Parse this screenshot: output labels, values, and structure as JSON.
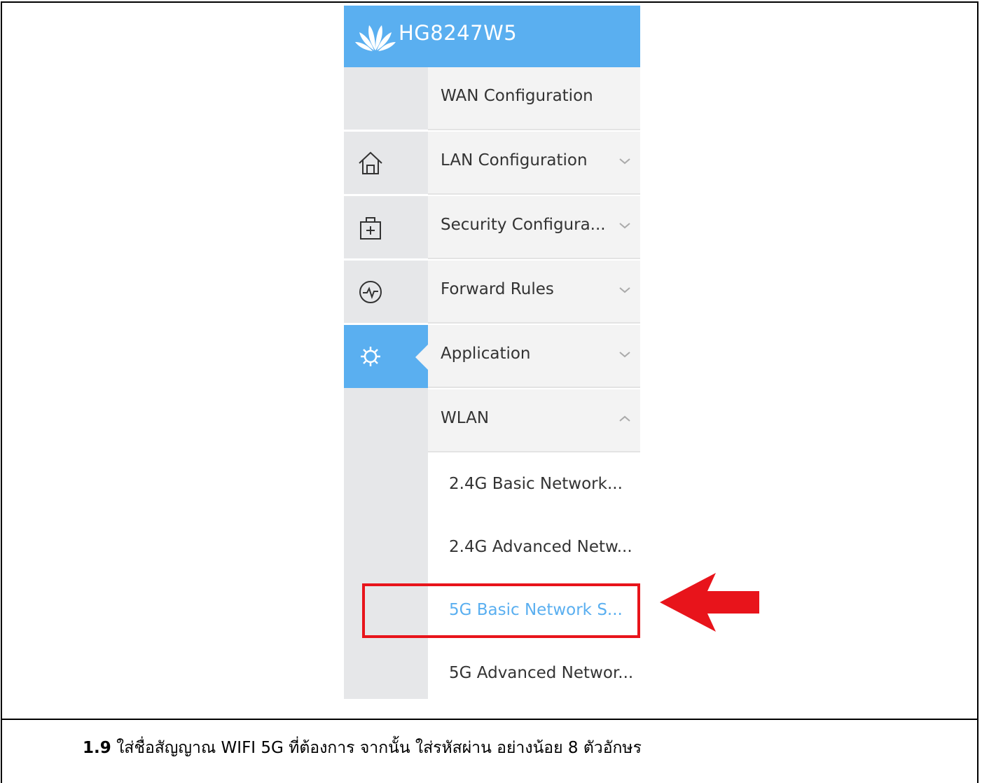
{
  "app": {
    "model_name": "HG8247W5"
  },
  "left_rail": {
    "items": [
      {
        "icon": "home-icon",
        "active": false
      },
      {
        "icon": "medical-kit-icon",
        "active": false
      },
      {
        "icon": "activity-icon",
        "active": false
      },
      {
        "icon": "gear-icon",
        "active": true
      }
    ]
  },
  "menu": {
    "items": [
      {
        "label": "WAN Configuration",
        "chevron": "none"
      },
      {
        "label": "LAN Configuration",
        "chevron": "down"
      },
      {
        "label": "Security Configura...",
        "chevron": "down"
      },
      {
        "label": "Forward Rules",
        "chevron": "down"
      },
      {
        "label": "Application",
        "chevron": "down"
      },
      {
        "label": "WLAN",
        "chevron": "up"
      }
    ],
    "sub_items": [
      {
        "label": "2.4G Basic Network..."
      },
      {
        "label": "2.4G Advanced Netw..."
      },
      {
        "label": "5G Basic Network S...",
        "selected": true
      },
      {
        "label": "5G Advanced Networ..."
      }
    ]
  },
  "caption": {
    "step": "1.9",
    "text": "ใส่ชื่อสัญญาณ WIFI 5G ที่ต้องการ จากนั้น ใส่รหัสผ่าน อย่างน้อย 8 ตัวอักษร"
  },
  "colors": {
    "brand_blue": "#5aaff0",
    "highlight_red": "#e8141b"
  }
}
